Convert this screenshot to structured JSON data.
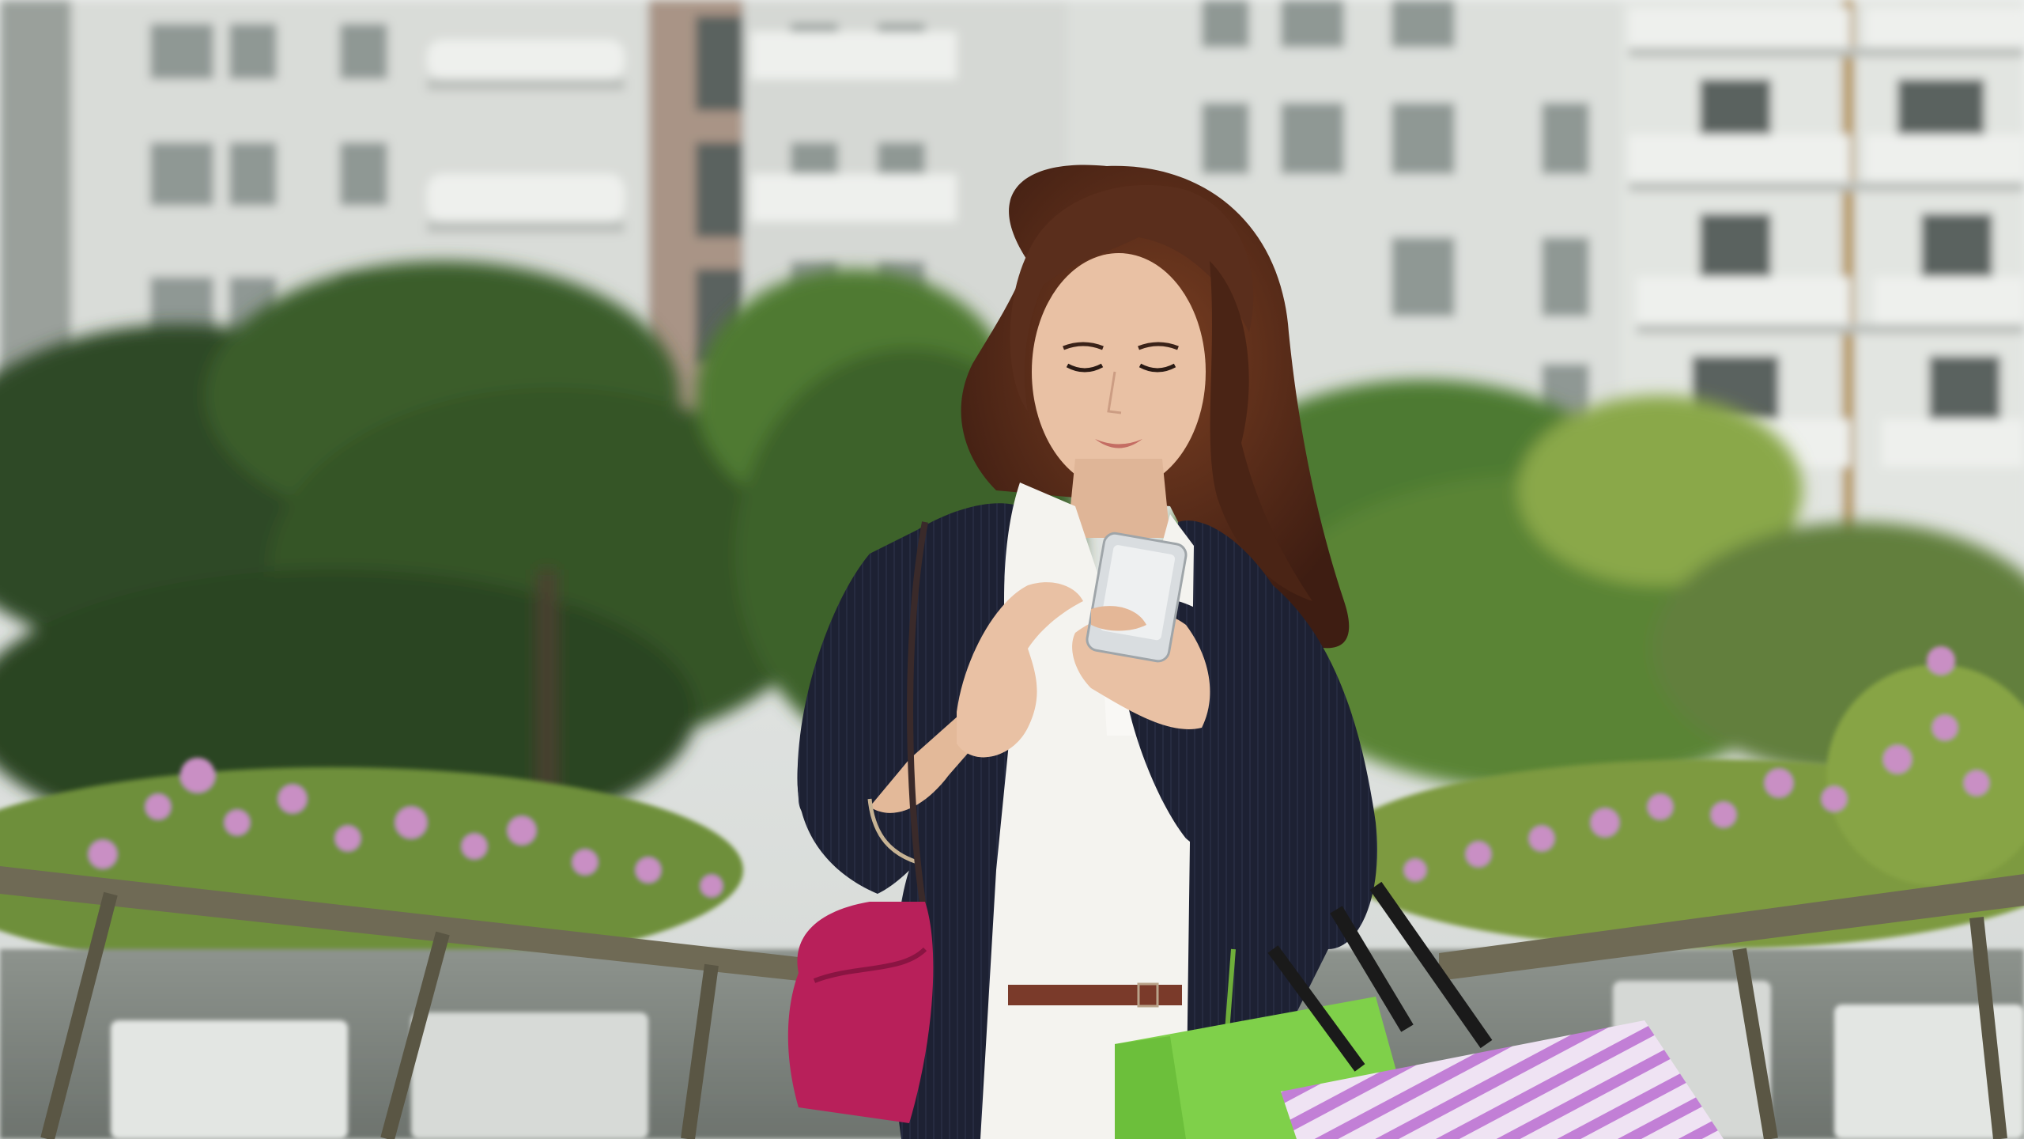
{
  "image": {
    "kind": "photograph",
    "colors": {
      "sky": "#e9ecec",
      "building_wall": "#d9dcd8",
      "building_shadow": "#b9bdb9",
      "window": "#8f9894",
      "window_dark": "#5a625f",
      "foliage_dark": "#2f4a25",
      "foliage_mid": "#4f7a33",
      "foliage_light": "#8aa84a",
      "flowers": "#c98fc4",
      "railing": "#6f6a55",
      "planter": "#e3e6e3",
      "hair": "#5a2e1c",
      "skin": "#e9c1a4",
      "cardigan": "#1d2133",
      "blouse": "#f4f3ef",
      "belt": "#7a3a2a",
      "handbag": "#b8205a",
      "phone": "#d9dde0",
      "bag_green": "#7fd04a",
      "bag_stripe_a": "#c27fd6",
      "bag_stripe_b": "#efe3f3"
    }
  }
}
